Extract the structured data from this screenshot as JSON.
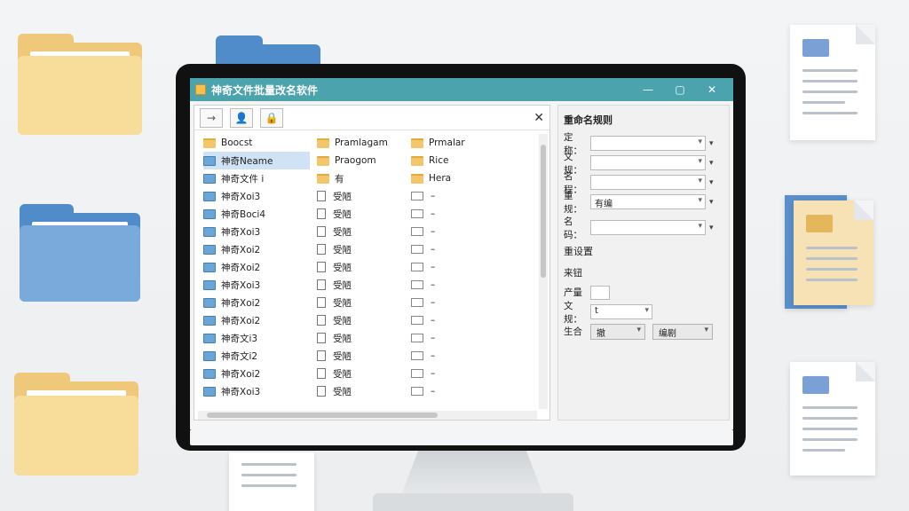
{
  "window": {
    "title": "神奇文件批量改名软件",
    "minimize": "—",
    "maximize": "▢",
    "close": "✕"
  },
  "toolbar": {
    "buttons": [
      "→",
      "👤",
      "🔒"
    ],
    "close": "✕"
  },
  "file_columns": [
    [
      {
        "name": "Boocst",
        "icon": "folder-yellow",
        "selected": false
      },
      {
        "name": "神奇Neame",
        "icon": "folder-blue",
        "selected": true
      },
      {
        "name": "神奇文件 i",
        "icon": "folder-blue",
        "selected": false
      },
      {
        "name": "神奇Xoi3",
        "icon": "folder-blue",
        "selected": false
      },
      {
        "name": "神奇Boci4",
        "icon": "folder-blue",
        "selected": false
      },
      {
        "name": "神奇Xoi3",
        "icon": "folder-blue",
        "selected": false
      },
      {
        "name": "神奇Xoi2",
        "icon": "folder-blue",
        "selected": false
      },
      {
        "name": "神奇Xoi2",
        "icon": "folder-blue",
        "selected": false
      },
      {
        "name": "神奇Xoi3",
        "icon": "folder-blue",
        "selected": false
      },
      {
        "name": "神奇Xoi2",
        "icon": "folder-blue",
        "selected": false
      },
      {
        "name": "神奇Xoi2",
        "icon": "folder-blue",
        "selected": false
      },
      {
        "name": "神奇文i3",
        "icon": "folder-blue",
        "selected": false
      },
      {
        "name": "神奇文i2",
        "icon": "folder-blue",
        "selected": false
      },
      {
        "name": "神奇Xoi2",
        "icon": "folder-blue",
        "selected": false
      },
      {
        "name": "神奇Xoi3",
        "icon": "folder-blue",
        "selected": false
      }
    ],
    [
      {
        "name": "Pramlagam",
        "icon": "folder-yellow"
      },
      {
        "name": "Praogom",
        "icon": "folder-yellow"
      },
      {
        "name": "有",
        "icon": "folder-yellow"
      },
      {
        "name": "受陋",
        "icon": "page"
      },
      {
        "name": "受陋",
        "icon": "page"
      },
      {
        "name": "受陋",
        "icon": "page"
      },
      {
        "name": "受陋",
        "icon": "page"
      },
      {
        "name": "受陋",
        "icon": "page"
      },
      {
        "name": "受陋",
        "icon": "page"
      },
      {
        "name": "受陋",
        "icon": "page"
      },
      {
        "name": "受陋",
        "icon": "page"
      },
      {
        "name": "受陋",
        "icon": "page"
      },
      {
        "name": "受陋",
        "icon": "page"
      },
      {
        "name": "受陋",
        "icon": "page"
      },
      {
        "name": "受陋",
        "icon": "page"
      }
    ],
    [
      {
        "name": "Prmalar",
        "icon": "folder-yellow"
      },
      {
        "name": "Rice",
        "icon": "folder-yellow"
      },
      {
        "name": "Hera",
        "icon": "folder-yellow"
      },
      {
        "name": "–",
        "icon": "box"
      },
      {
        "name": "–",
        "icon": "box"
      },
      {
        "name": "–",
        "icon": "box"
      },
      {
        "name": "–",
        "icon": "box"
      },
      {
        "name": "–",
        "icon": "box"
      },
      {
        "name": "–",
        "icon": "box"
      },
      {
        "name": "–",
        "icon": "box"
      },
      {
        "name": "–",
        "icon": "box"
      },
      {
        "name": "–",
        "icon": "box"
      },
      {
        "name": "–",
        "icon": "box"
      },
      {
        "name": "–",
        "icon": "box"
      },
      {
        "name": "–",
        "icon": "box"
      }
    ]
  ],
  "rules_panel": {
    "title": "重命名规则",
    "fields": [
      {
        "label": "定称：",
        "value": ""
      },
      {
        "label": "文规：",
        "value": ""
      },
      {
        "label": "名程：",
        "value": ""
      },
      {
        "label": "重规：",
        "value": "有编"
      },
      {
        "label": "名码：",
        "value": ""
      }
    ],
    "section": "重设置",
    "source_label": "来钮",
    "produce_label": "产量",
    "mode_label": "文规：",
    "mode_value": "t",
    "action_label": "生合",
    "action_btn1": "撤",
    "action_btn2": "编剧"
  }
}
